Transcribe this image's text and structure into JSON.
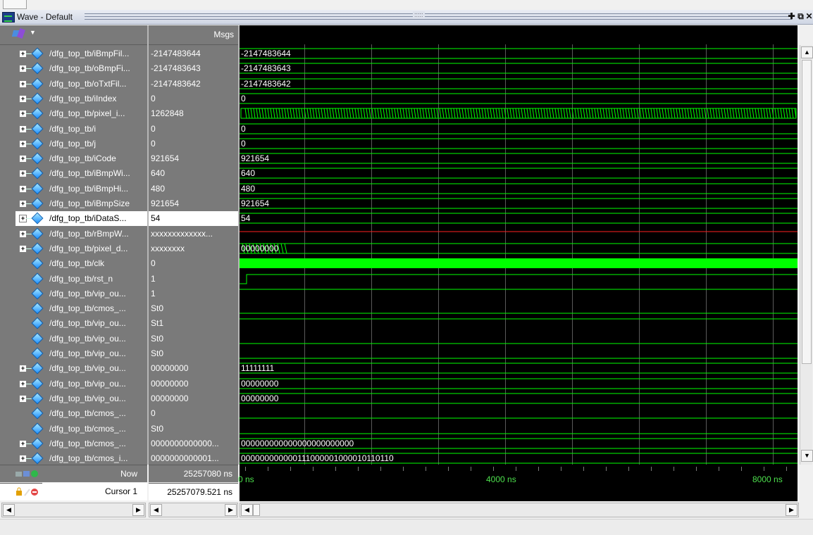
{
  "window": {
    "title": "Wave - Default",
    "grip_dots": ":::::"
  },
  "header": {
    "msgs_label": "Msgs"
  },
  "signals": [
    {
      "name": "/dfg_top_tb/iBmpFil...",
      "value": "-2147483644",
      "expandable": true,
      "wave": "-2147483644"
    },
    {
      "name": "/dfg_top_tb/oBmpFi...",
      "value": "-2147483643",
      "expandable": true,
      "wave": "-2147483643"
    },
    {
      "name": "/dfg_top_tb/oTxtFil...",
      "value": "-2147483642",
      "expandable": true,
      "wave": "-2147483642"
    },
    {
      "name": "/dfg_top_tb/iIndex",
      "value": "0",
      "expandable": true,
      "wave": "0"
    },
    {
      "name": "/dfg_top_tb/pixel_i...",
      "value": "1262848",
      "expandable": true,
      "wave": ""
    },
    {
      "name": "/dfg_top_tb/i",
      "value": "0",
      "expandable": true,
      "wave": "0"
    },
    {
      "name": "/dfg_top_tb/j",
      "value": "0",
      "expandable": true,
      "wave": "0"
    },
    {
      "name": "/dfg_top_tb/iCode",
      "value": "921654",
      "expandable": true,
      "wave": "921654"
    },
    {
      "name": "/dfg_top_tb/iBmpWi...",
      "value": "640",
      "expandable": true,
      "wave": "640"
    },
    {
      "name": "/dfg_top_tb/iBmpHi...",
      "value": "480",
      "expandable": true,
      "wave": "480"
    },
    {
      "name": "/dfg_top_tb/iBmpSize",
      "value": "921654",
      "expandable": true,
      "wave": "921654"
    },
    {
      "name": "/dfg_top_tb/iDataS...",
      "value": "54",
      "expandable": true,
      "wave": "54",
      "selected": true
    },
    {
      "name": "/dfg_top_tb/rBmpW...",
      "value": "xxxxxxxxxxxxx...",
      "expandable": true,
      "wave": ""
    },
    {
      "name": "/dfg_top_tb/pixel_d...",
      "value": "xxxxxxxx",
      "expandable": true,
      "wave": "00000000"
    },
    {
      "name": "/dfg_top_tb/clk",
      "value": "0",
      "expandable": false,
      "wave": ""
    },
    {
      "name": "/dfg_top_tb/rst_n",
      "value": "1",
      "expandable": false,
      "wave": ""
    },
    {
      "name": "/dfg_top_tb/vip_ou...",
      "value": "1",
      "expandable": false,
      "wave": ""
    },
    {
      "name": "/dfg_top_tb/cmos_...",
      "value": "St0",
      "expandable": false,
      "wave": ""
    },
    {
      "name": "/dfg_top_tb/vip_ou...",
      "value": "St1",
      "expandable": false,
      "wave": ""
    },
    {
      "name": "/dfg_top_tb/vip_ou...",
      "value": "St0",
      "expandable": false,
      "wave": ""
    },
    {
      "name": "/dfg_top_tb/vip_ou...",
      "value": "St0",
      "expandable": false,
      "wave": ""
    },
    {
      "name": "/dfg_top_tb/vip_ou...",
      "value": "00000000",
      "expandable": true,
      "wave": "11111111"
    },
    {
      "name": "/dfg_top_tb/vip_ou...",
      "value": "00000000",
      "expandable": true,
      "wave": "00000000"
    },
    {
      "name": "/dfg_top_tb/vip_ou...",
      "value": "00000000",
      "expandable": true,
      "wave": "00000000"
    },
    {
      "name": "/dfg_top_tb/cmos_...",
      "value": "0",
      "expandable": false,
      "wave": ""
    },
    {
      "name": "/dfg_top_tb/cmos_...",
      "value": "St0",
      "expandable": false,
      "wave": ""
    },
    {
      "name": "/dfg_top_tb/cmos_...",
      "value": "0000000000000...",
      "expandable": true,
      "wave": "000000000000000000000000"
    },
    {
      "name": "/dfg_top_tb/cmos_i...",
      "value": "0000000000001...",
      "expandable": true,
      "wave": "000000000000111000001000010110110"
    }
  ],
  "footer": {
    "now_label": "Now",
    "now_value": "25257080 ns",
    "cursor_label": "Cursor 1",
    "cursor_value": "25257079.521 ns"
  },
  "timeline": {
    "labels": [
      "0 ns",
      "4000 ns",
      "8000 ns"
    ]
  },
  "colors": {
    "wave_green": "#00ff00",
    "red_x": "#ff2020",
    "pane_gray": "#7a7a7a"
  }
}
